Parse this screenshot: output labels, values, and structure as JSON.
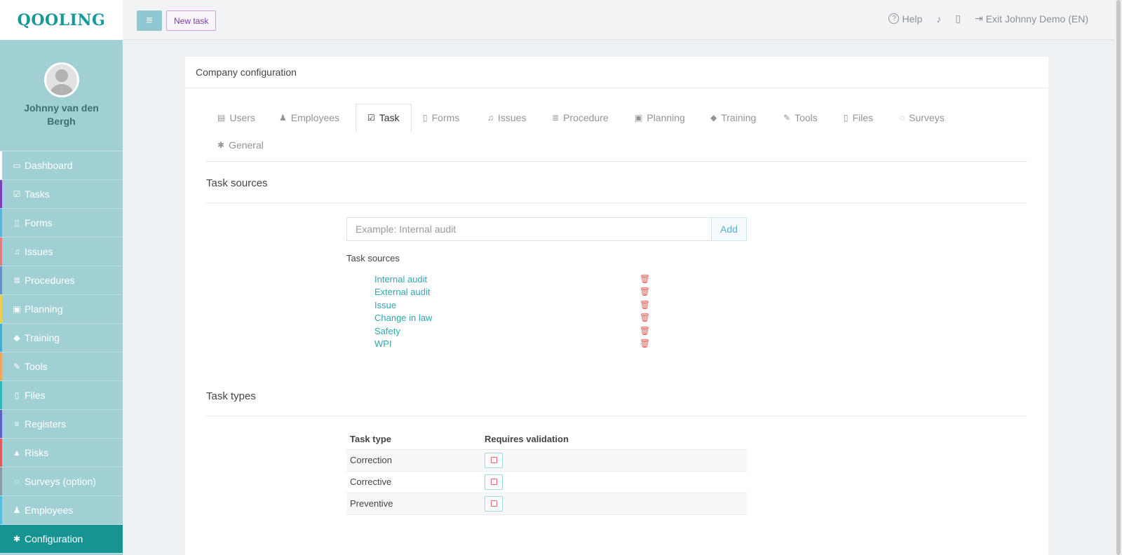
{
  "brand": {
    "logo_text": "QOOLING"
  },
  "profile": {
    "name": "Johnny van den Bergh"
  },
  "sidebar": {
    "items": [
      {
        "label": "Dashboard",
        "icon": "monitor-icon",
        "glyph": "▭",
        "bar": "#ffffff"
      },
      {
        "label": "Tasks",
        "icon": "check-square-icon",
        "glyph": "☑",
        "bar": "#7b3fb8"
      },
      {
        "label": "Forms",
        "icon": "document-icon",
        "glyph": "▯",
        "bar": "#5ab2e0"
      },
      {
        "label": "Issues",
        "icon": "bell-icon",
        "glyph": "♫",
        "bar": "#e57b7b"
      },
      {
        "label": "Procedures",
        "icon": "list-icon",
        "glyph": "≣",
        "bar": "#6c8fc8"
      },
      {
        "label": "Planning",
        "icon": "calendar-icon",
        "glyph": "▣",
        "bar": "#e8d24a"
      },
      {
        "label": "Training",
        "icon": "graduation-cap-icon",
        "glyph": "◆",
        "bar": "#3cb0d8"
      },
      {
        "label": "Tools",
        "icon": "wrench-icon",
        "glyph": "✎",
        "bar": "#e8a860"
      },
      {
        "label": "Files",
        "icon": "file-pdf-icon",
        "glyph": "▯",
        "bar": "#2fb6c0"
      },
      {
        "label": "Registers",
        "icon": "table-list-icon",
        "glyph": "≡",
        "bar": "#5a5fc0"
      },
      {
        "label": "Risks",
        "icon": "warning-icon",
        "glyph": "▲",
        "bar": "#e05a5a"
      },
      {
        "label": "Surveys (option)",
        "icon": "comment-icon",
        "glyph": "◌",
        "bar": "#8a9aa0"
      },
      {
        "label": "Employees",
        "icon": "users-icon",
        "glyph": "♟",
        "bar": "#4cc0e0"
      },
      {
        "label": "Configuration",
        "icon": "gear-icon",
        "glyph": "✱",
        "bar": "#179393",
        "active": true
      }
    ]
  },
  "toolbar": {
    "menu_glyph": "≡",
    "new_task_label": "New task",
    "help_label": "Help",
    "help_glyph": "?",
    "bell_glyph": "♪",
    "tablet_glyph": "▯",
    "exit_label": "Exit Johnny Demo (EN)",
    "exit_glyph": "⇥"
  },
  "panel": {
    "title": "Company configuration"
  },
  "tabs": [
    {
      "label": "Users",
      "icon": "id-card-icon",
      "glyph": "▤"
    },
    {
      "label": "Employees",
      "icon": "users-icon",
      "glyph": "♟"
    },
    {
      "label": "Task",
      "icon": "check-square-icon",
      "glyph": "☑",
      "active": true
    },
    {
      "label": "Forms",
      "icon": "document-icon",
      "glyph": "▯"
    },
    {
      "label": "Issues",
      "icon": "bell-icon",
      "glyph": "♫"
    },
    {
      "label": "Procedure",
      "icon": "list-icon",
      "glyph": "≣"
    },
    {
      "label": "Planning",
      "icon": "calendar-icon",
      "glyph": "▣"
    },
    {
      "label": "Training",
      "icon": "graduation-cap-icon",
      "glyph": "◆"
    },
    {
      "label": "Tools",
      "icon": "wrench-icon",
      "glyph": "✎"
    },
    {
      "label": "Files",
      "icon": "file-icon",
      "glyph": "▯"
    },
    {
      "label": "Surveys",
      "icon": "comment-icon",
      "glyph": "◌"
    },
    {
      "label": "General",
      "icon": "gear-icon",
      "glyph": "✱"
    }
  ],
  "task_sources": {
    "section_title": "Task sources",
    "input_placeholder": "Example: Internal audit",
    "add_label": "Add",
    "list_label": "Task sources",
    "trash_glyph": "🗑",
    "items": [
      "Internal audit",
      "External audit",
      "Issue",
      "Change in law",
      "Safety",
      "WPI"
    ]
  },
  "task_types": {
    "section_title": "Task types",
    "col_type": "Task type",
    "col_validation": "Requires validation",
    "rows": [
      {
        "type": "Correction",
        "requires_validation": false
      },
      {
        "type": "Corrective",
        "requires_validation": false
      },
      {
        "type": "Preventive",
        "requires_validation": false
      }
    ]
  }
}
